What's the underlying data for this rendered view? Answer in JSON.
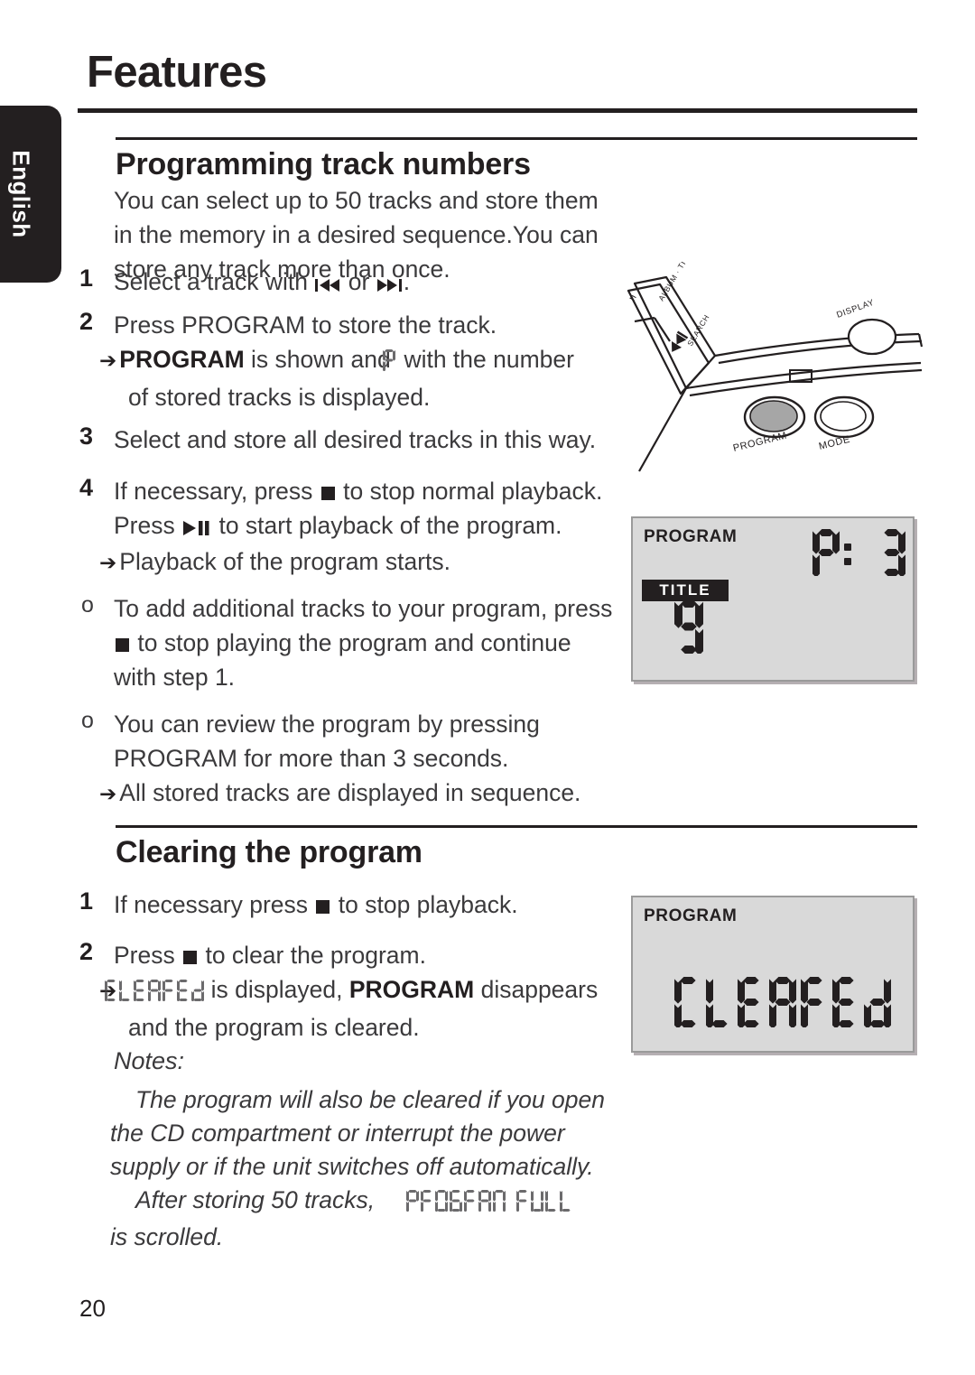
{
  "page": {
    "title": "Features",
    "number": "20",
    "language_tab": "English"
  },
  "sections": [
    {
      "heading": "Programming track numbers",
      "intro": "You can select up to 50 tracks and store them in the memory in a desired sequence.You can store any track more than once.",
      "steps": [
        {
          "marker": "1",
          "marker_type": "number",
          "text_a": "Select a track with ",
          "icon_a": "previous-track-icon",
          "text_b": " or ",
          "icon_b": "next-track-icon",
          "text_c": "."
        },
        {
          "marker": "2",
          "marker_type": "number",
          "text_a": "Press PROGRAM to store the track.",
          "sub_arrow": "➔",
          "sub_bold": "PROGRAM",
          "sub_a": " is shown and ",
          "sub_lcd": "P",
          "sub_b": " with the number",
          "sub_c": "of stored tracks is displayed."
        },
        {
          "marker": "3",
          "marker_type": "number",
          "text_a": "Select and store all desired tracks in this way."
        },
        {
          "marker": "4",
          "marker_type": "number",
          "text_a": "If necessary, press ",
          "icon_a": "stop-icon",
          "text_b": " to stop normal playback.",
          "line2_a": "Press ",
          "icon_b": "play-pause-icon",
          "line2_b": " to start playback of the program.",
          "sub_arrow": "➔",
          "sub_a": "Playback of the program starts."
        },
        {
          "marker": "o",
          "marker_type": "bullet",
          "text_a": "To add additional tracks to your program, press",
          "icon_a": "stop-icon",
          "text_b": " to stop playing the program and continue",
          "text_c": "with step 1."
        },
        {
          "marker": "o",
          "marker_type": "bullet",
          "text_a": "You can review the program by pressing",
          "text_b": "PROGRAM for more than 3 seconds.",
          "sub_arrow": "➔",
          "sub_a": "All stored tracks are displayed in sequence."
        }
      ]
    },
    {
      "heading": "Clearing the program",
      "steps": [
        {
          "marker": "1",
          "marker_type": "number",
          "text_a": "If necessary press ",
          "icon_a": "stop-icon",
          "text_b": " to stop playback."
        },
        {
          "marker": "2",
          "marker_type": "number",
          "text_a": "Press ",
          "icon_a": "stop-icon",
          "text_b": " to clear the program.",
          "sub_arrow": "➔",
          "sub_lcd": "CLEARED",
          "sub_a": " is displayed, ",
          "sub_bold": "PROGRAM",
          "sub_b": " disappears",
          "sub_c": "and the program is cleared."
        }
      ],
      "notes_label": "Notes:",
      "notes": [
        "The program will also be cleared if you open the CD compartment or interrupt the power supply or if the unit switches off automatically.",
        "After storing 50 tracks, "
      ],
      "notes_lcd": "PROGRAM FULL",
      "notes_tail": "is scrolled."
    }
  ],
  "illustration": {
    "name": "cd-player-control-panel",
    "labels": {
      "search": "SEARCH",
      "album_title": "ALBUM · TITLE",
      "display": "DISPLAY",
      "program": "PROGRAM",
      "mode": "MODE"
    },
    "highlighted_button": "PROGRAM"
  },
  "lcd_displays": [
    {
      "name": "lcd-program-display",
      "indicator": "PROGRAM",
      "badge": "TITLE",
      "top_segments": "P: 3",
      "big_segment": "9"
    },
    {
      "name": "lcd-cleared-display",
      "indicator": "PROGRAM",
      "segments": "CLEARED"
    }
  ],
  "colors": {
    "ink": "#231f20",
    "body_text": "#3b3a3c",
    "lcd_background": "#d9d9d9",
    "lcd_border": "#9a9a9a",
    "tab_background": "#231f20"
  }
}
